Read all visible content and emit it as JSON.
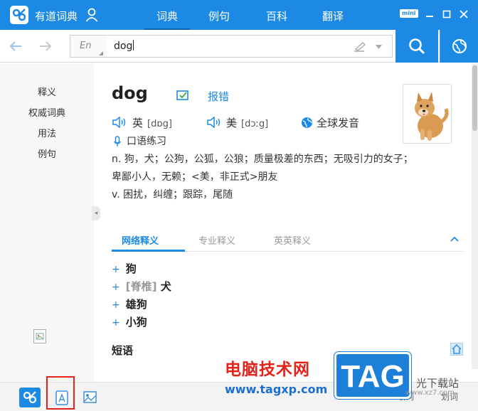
{
  "app": {
    "title": "有道词典",
    "nav_tabs": [
      "词典",
      "例句",
      "百科",
      "翻译"
    ],
    "mini_label": "mini"
  },
  "search": {
    "lang_label": "En",
    "query": "dog"
  },
  "sidebar": {
    "items": [
      "释义",
      "权威词典",
      "用法",
      "例句"
    ]
  },
  "entry": {
    "word": "dog",
    "report_label": "报错",
    "pron_uk_label": "英",
    "pron_uk_phonetic": "[dɒg]",
    "pron_us_label": "美",
    "pron_us_phonetic": "[dɔːg]",
    "global_pron_label": "全球发音",
    "oral_practice_label": "口语练习",
    "definitions": [
      "n. 狗，犬；公狗，公狐，公狼；质量极差的东西；无吸引力的女子；",
      "卑鄙小人，无赖；<美，非正式>朋友",
      "v. 困扰，纠缠；跟踪，尾随"
    ]
  },
  "def_tabs": [
    "网络释义",
    "专业释义",
    "英英释义"
  ],
  "net_definitions": [
    {
      "tag": "",
      "text": "狗"
    },
    {
      "tag": "[脊椎]",
      "text": "犬"
    },
    {
      "tag": "",
      "text": "雄狗"
    },
    {
      "tag": "",
      "text": "小狗"
    }
  ],
  "phrases_heading": "短语",
  "bottom": {
    "right_label_1": "取词",
    "right_label_2": "划词"
  },
  "watermark": {
    "cn": "电脑技术网",
    "url": "www.tagxp.com",
    "badge": "TAG",
    "site": "光下载站",
    "site_url": "www.xz7.com"
  },
  "colors": {
    "brand_blue": "#1c8ae4",
    "highlight_red": "#e2231a"
  }
}
